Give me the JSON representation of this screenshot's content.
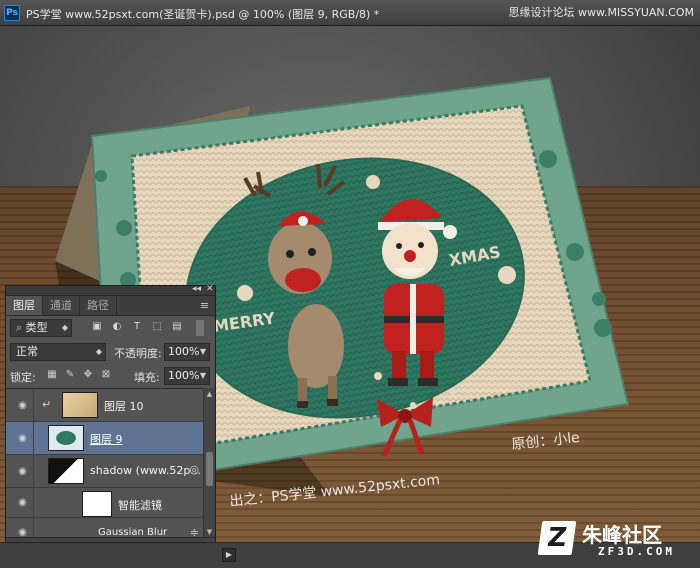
{
  "window": {
    "app_logo": "Ps",
    "title": "PS学堂 www.52psxt.com(圣诞贺卡).psd @ 100% (图层 9, RGB/8) *",
    "watermark_top": "思缘设计论坛 www.MISSYUAN.COM"
  },
  "canvas": {
    "card_text_left": "MERRY",
    "card_text_right": "XMAS",
    "watermark_site": "出之：PS学堂 www.52psxt.com",
    "watermark_author": "原创：小le"
  },
  "layers_panel": {
    "collapse_glyph": "◂◂",
    "close_glyph": "✕",
    "tabs": [
      {
        "label": "图层",
        "active": true
      },
      {
        "label": "通道",
        "active": false
      },
      {
        "label": "路径",
        "active": false
      }
    ],
    "menu_icon": "≡",
    "filter": {
      "kind_label": "类型",
      "icons": [
        "image-filter-icon",
        "adjustment-filter-icon",
        "type-filter-icon",
        "shape-filter-icon",
        "smart-object-filter-icon"
      ]
    },
    "blend_mode": "正常",
    "opacity_label": "不透明度:",
    "opacity_value": "100%",
    "lock_label": "锁定:",
    "fill_label": "填充:",
    "fill_value": "100%",
    "layers": [
      {
        "name": "图层 10",
        "selected": false,
        "clipped": true
      },
      {
        "name": "图层 9",
        "selected": true,
        "clipped": false
      },
      {
        "name": "shadow (www.52p...",
        "selected": false,
        "clipped": false
      },
      {
        "name": "智能滤镜",
        "selected": false,
        "clipped": false
      },
      {
        "name": "Gaussian Blur",
        "selected": false,
        "clipped": false
      }
    ],
    "footer_icons": [
      "link-layers-icon",
      "fx-icon",
      "mask-icon",
      "adjustment-icon",
      "group-icon",
      "new-layer-icon",
      "trash-icon"
    ]
  },
  "status": {
    "arrow": "▶"
  },
  "brand": {
    "logo_letter": "Z",
    "name_cn": "朱峰社区",
    "name_en": "ZF3D.COM"
  },
  "colors": {
    "card_green": "#6ea58c",
    "oval_green": "#2f7a62",
    "knit_cream": "#e9dcc4",
    "santa_red": "#c0231f",
    "selection_blue": "#5f7395"
  }
}
